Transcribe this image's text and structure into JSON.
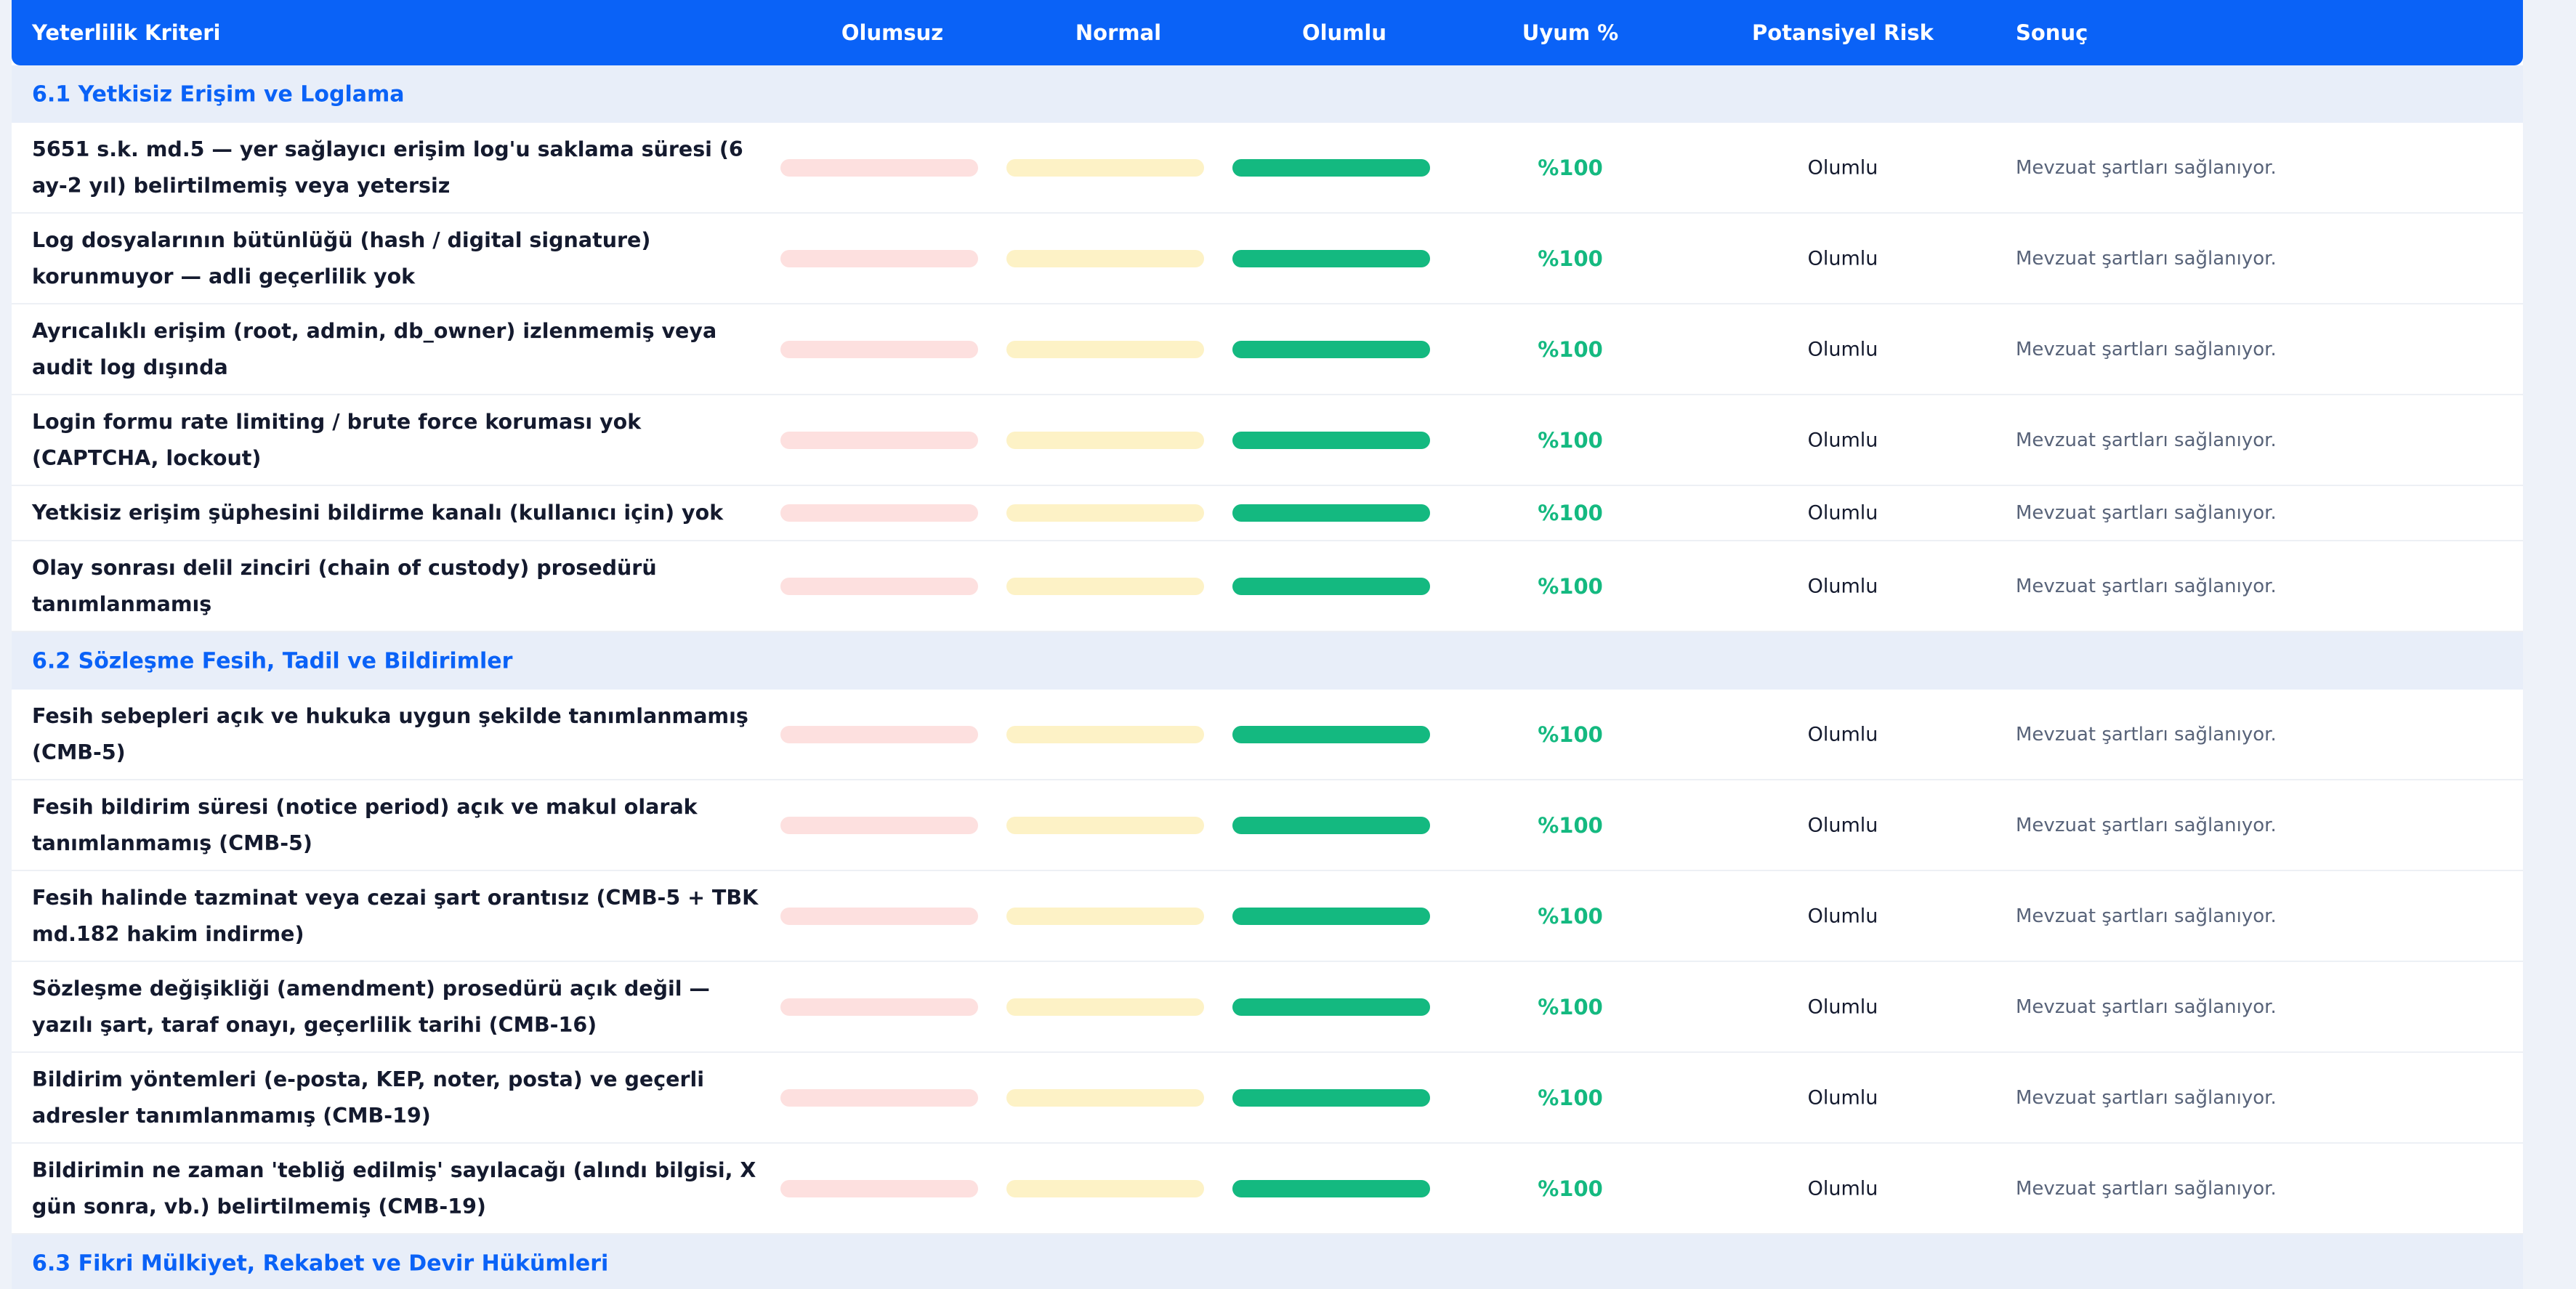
{
  "colors": {
    "header_bg": "#0a62f7",
    "section_bg": "#e8eef9",
    "section_text": "#0a62f7",
    "olumsuz_track": "#fde0df",
    "normal_track": "#fdf2c6",
    "olumlu_fill": "#14b980"
  },
  "header": {
    "criterion": "Yeterlilik Kriteri",
    "olumsuz": "Olumsuz",
    "normal": "Normal",
    "olumlu": "Olumlu",
    "uyum": "Uyum %",
    "risk": "Potansiyel Risk",
    "sonuc": "Sonuç"
  },
  "sections": [
    {
      "title": "6.1 Yetkisiz Erişim ve Loglama",
      "rows": [
        {
          "criterion": "5651 s.k. md.5 — yer sağlayıcı erişim log'u saklama süresi (6 ay-2 yıl) belirtilmemiş veya yetersiz",
          "olumsuz": 0,
          "normal": 0,
          "olumlu": 1,
          "uyum": "%100",
          "risk": "Olumlu",
          "sonuc": "Mevzuat şartları sağlanıyor."
        },
        {
          "criterion": "Log dosyalarının bütünlüğü (hash / digital signature) korunmuyor — adli geçerlilik yok",
          "olumsuz": 0,
          "normal": 0,
          "olumlu": 1,
          "uyum": "%100",
          "risk": "Olumlu",
          "sonuc": "Mevzuat şartları sağlanıyor."
        },
        {
          "criterion": "Ayrıcalıklı erişim (root, admin, db_owner) izlenmemiş veya audit log dışında",
          "olumsuz": 0,
          "normal": 0,
          "olumlu": 1,
          "uyum": "%100",
          "risk": "Olumlu",
          "sonuc": "Mevzuat şartları sağlanıyor."
        },
        {
          "criterion": "Login formu rate limiting / brute force koruması yok (CAPTCHA, lockout)",
          "olumsuz": 0,
          "normal": 0,
          "olumlu": 1,
          "uyum": "%100",
          "risk": "Olumlu",
          "sonuc": "Mevzuat şartları sağlanıyor."
        },
        {
          "criterion": "Yetkisiz erişim şüphesini bildirme kanalı (kullanıcı için) yok",
          "olumsuz": 0,
          "normal": 0,
          "olumlu": 1,
          "uyum": "%100",
          "risk": "Olumlu",
          "sonuc": "Mevzuat şartları sağlanıyor.",
          "short": true
        },
        {
          "criterion": "Olay sonrası delil zinciri (chain of custody) prosedürü tanımlanmamış",
          "olumsuz": 0,
          "normal": 0,
          "olumlu": 1,
          "uyum": "%100",
          "risk": "Olumlu",
          "sonuc": "Mevzuat şartları sağlanıyor."
        }
      ]
    },
    {
      "title": "6.2 Sözleşme Fesih, Tadil ve Bildirimler",
      "rows": [
        {
          "criterion": "Fesih sebepleri açık ve hukuka uygun şekilde tanımlanmamış (CMB-5)",
          "olumsuz": 0,
          "normal": 0,
          "olumlu": 1,
          "uyum": "%100",
          "risk": "Olumlu",
          "sonuc": "Mevzuat şartları sağlanıyor."
        },
        {
          "criterion": "Fesih bildirim süresi (notice period) açık ve makul olarak tanımlanmamış (CMB-5)",
          "olumsuz": 0,
          "normal": 0,
          "olumlu": 1,
          "uyum": "%100",
          "risk": "Olumlu",
          "sonuc": "Mevzuat şartları sağlanıyor."
        },
        {
          "criterion": "Fesih halinde tazminat veya cezai şart orantısız (CMB-5 + TBK md.182 hakim indirme)",
          "olumsuz": 0,
          "normal": 0,
          "olumlu": 1,
          "uyum": "%100",
          "risk": "Olumlu",
          "sonuc": "Mevzuat şartları sağlanıyor."
        },
        {
          "criterion": "Sözleşme değişikliği (amendment) prosedürü açık değil — yazılı şart, taraf onayı, geçerlilik tarihi (CMB-16)",
          "olumsuz": 0,
          "normal": 0,
          "olumlu": 1,
          "uyum": "%100",
          "risk": "Olumlu",
          "sonuc": "Mevzuat şartları sağlanıyor."
        },
        {
          "criterion": "Bildirim yöntemleri (e-posta, KEP, noter, posta) ve geçerli adresler tanımlanmamış (CMB-19)",
          "olumsuz": 0,
          "normal": 0,
          "olumlu": 1,
          "uyum": "%100",
          "risk": "Olumlu",
          "sonuc": "Mevzuat şartları sağlanıyor."
        },
        {
          "criterion": "Bildirimin ne zaman 'tebliğ edilmiş' sayılacağı (alındı bilgisi, X gün sonra, vb.) belirtilmemiş (CMB-19)",
          "olumsuz": 0,
          "normal": 0,
          "olumlu": 1,
          "uyum": "%100",
          "risk": "Olumlu",
          "sonuc": "Mevzuat şartları sağlanıyor."
        }
      ]
    },
    {
      "title": "6.3 Fikri Mülkiyet, Rekabet ve Devir Hükümleri",
      "rows": []
    }
  ]
}
